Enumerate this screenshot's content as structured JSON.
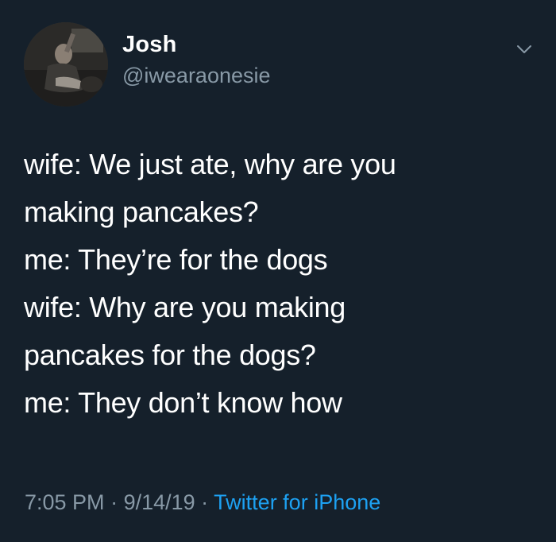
{
  "author": {
    "display_name": "Josh",
    "handle": "@iwearaonesie"
  },
  "tweet": {
    "lines": [
      "wife: We just ate, why are you",
      "making pancakes?",
      "me: They’re for the dogs",
      "wife: Why are you making",
      "pancakes for the dogs?",
      "me: They don’t know how"
    ]
  },
  "meta": {
    "time": "7:05 PM",
    "separator": " · ",
    "date": "9/14/19",
    "source": "Twitter for iPhone"
  },
  "icons": {
    "menu": "chevron-down-icon"
  },
  "colors": {
    "background": "#15202b",
    "text": "#ffffff",
    "secondary": "#8899a6",
    "link": "#1da1f2"
  }
}
